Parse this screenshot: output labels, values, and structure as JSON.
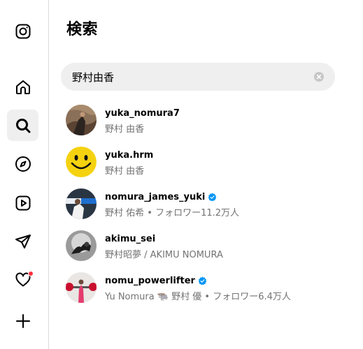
{
  "panel": {
    "title": "検索"
  },
  "search": {
    "value": "野村由香"
  },
  "results": [
    {
      "username": "yuka_nomura7",
      "subtitle": "野村 由香",
      "verified": false
    },
    {
      "username": "yuka.hrm",
      "subtitle": "野村 由香",
      "verified": false
    },
    {
      "username": "nomura_james_yuki",
      "subtitle": "野村 佑希 • フォロワー11.2万人",
      "verified": true
    },
    {
      "username": "akimu_sei",
      "subtitle": "野村昭夢 / AKIMU NOMURA",
      "verified": false
    },
    {
      "username": "nomu_powerlifter",
      "subtitle": "Yu Nomura 🐃 野村 優 • フォロワー6.4万人",
      "verified": true
    }
  ],
  "nav": [
    {
      "name": "instagram-logo-icon"
    },
    {
      "name": "home-icon"
    },
    {
      "name": "search-icon"
    },
    {
      "name": "explore-compass-icon"
    },
    {
      "name": "reels-icon"
    },
    {
      "name": "messages-send-icon"
    },
    {
      "name": "notifications-heart-icon"
    },
    {
      "name": "create-plus-icon"
    }
  ],
  "colors": {
    "verified": "#0095f6",
    "notification": "#ff3040",
    "secondary_text": "#737373"
  }
}
